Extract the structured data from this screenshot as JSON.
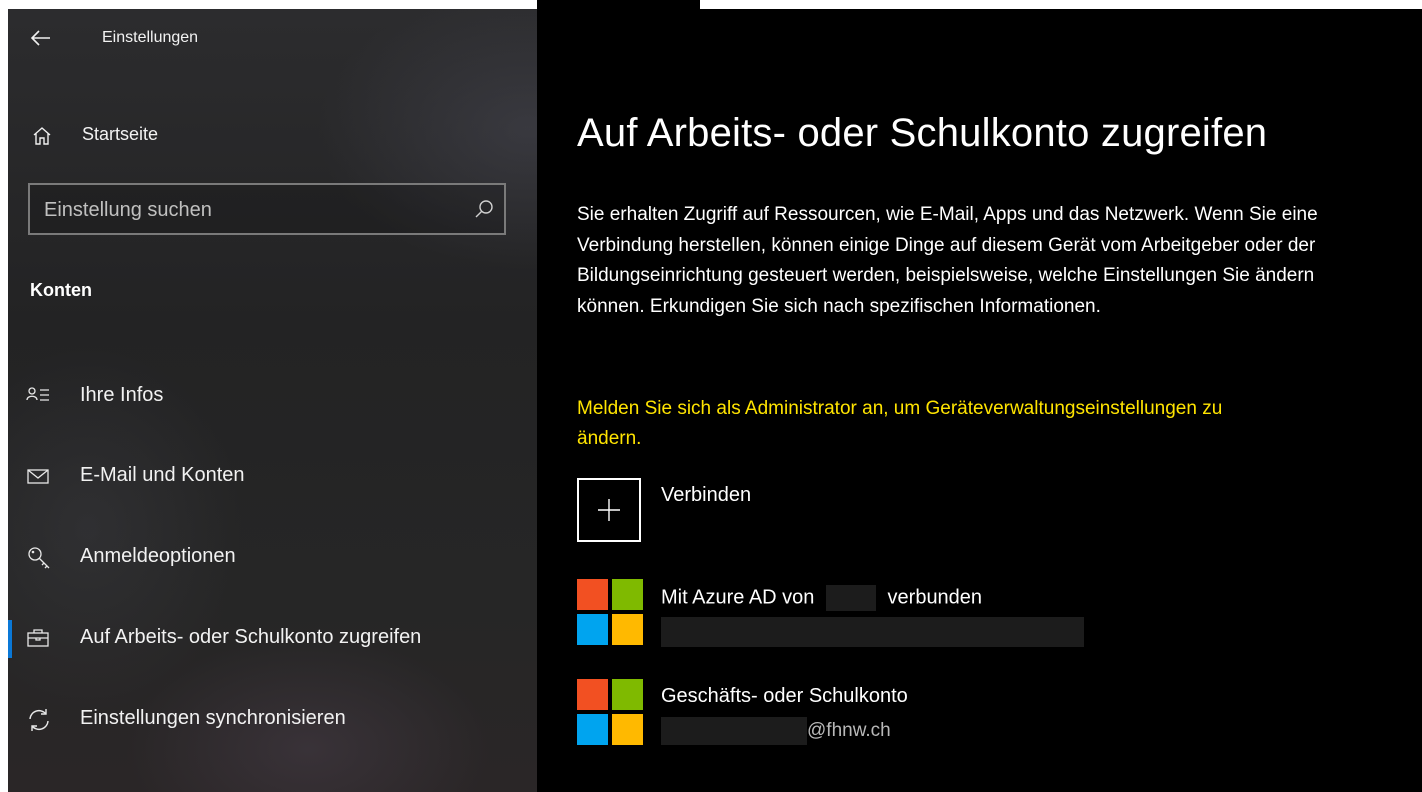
{
  "sidebar": {
    "app_title": "Einstellungen",
    "home_label": "Startseite",
    "search_placeholder": "Einstellung suchen",
    "section_heading": "Konten",
    "items": [
      {
        "label": "Ihre Infos",
        "icon": "person-list-icon"
      },
      {
        "label": "E-Mail und Konten",
        "icon": "mail-icon"
      },
      {
        "label": "Anmeldeoptionen",
        "icon": "key-icon"
      },
      {
        "label": "Auf Arbeits- oder Schulkonto zugreifen",
        "icon": "briefcase-icon",
        "active": true
      },
      {
        "label": "Einstellungen synchronisieren",
        "icon": "sync-icon"
      }
    ]
  },
  "main": {
    "title": "Auf Arbeits- oder Schulkonto zugreifen",
    "description": "Sie erhalten Zugriff auf Ressourcen, wie E-Mail, Apps und das Netzwerk. Wenn Sie eine Verbindung herstellen, können einige Dinge auf diesem Gerät vom Arbeitgeber oder der Bildungseinrichtung gesteuert werden, beispielsweise, welche Einstellungen Sie ändern können. Erkundigen Sie sich nach spezifischen Informationen.",
    "admin_note": "Melden Sie sich als Administrator an, um Geräteverwaltungseinstellungen zu ändern.",
    "connect_label": "Verbinden",
    "accounts": [
      {
        "title_prefix": "Mit Azure AD von",
        "title_suffix": "verbunden",
        "subtitle": ""
      },
      {
        "title": "Geschäfts- oder Schulkonto",
        "subtitle": "@fhnw.ch"
      }
    ]
  },
  "colors": {
    "accent": "#0a78d7",
    "warning_text": "#ffe400",
    "content_bg": "#000000",
    "ms_red": "#f25022",
    "ms_green": "#7fba00",
    "ms_blue": "#00a4ef",
    "ms_yellow": "#ffb900"
  }
}
